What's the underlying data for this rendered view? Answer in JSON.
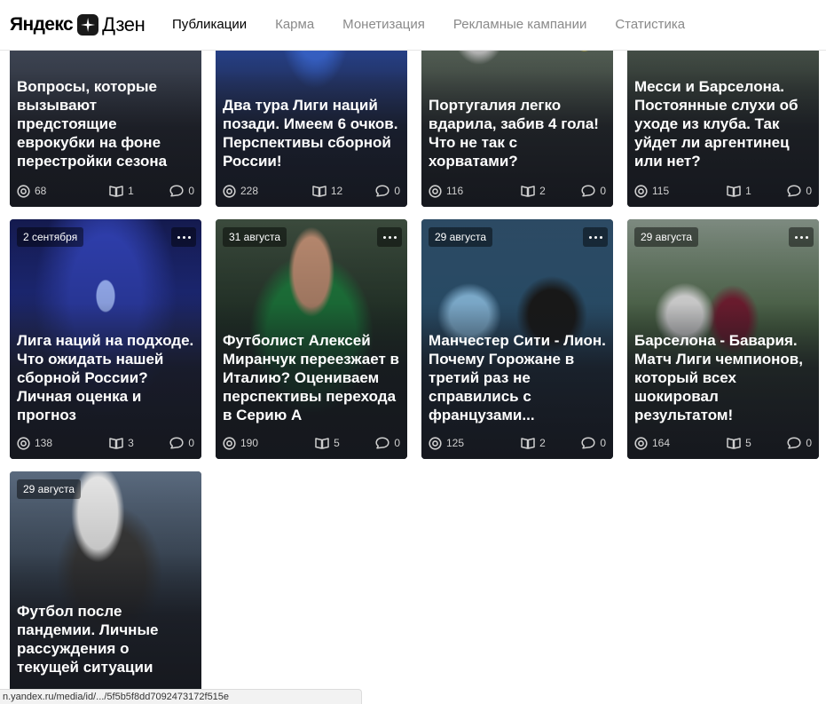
{
  "logo": {
    "yandex": "Яндекс",
    "zen": "Дзен"
  },
  "nav": [
    {
      "label": "Публикации",
      "active": true
    },
    {
      "label": "Карма",
      "active": false
    },
    {
      "label": "Монетизация",
      "active": false
    },
    {
      "label": "Рекламные кампании",
      "active": false
    },
    {
      "label": "Статистика",
      "active": false
    }
  ],
  "cards": [
    {
      "date": "",
      "title": "Вопросы, которые вызывают предстоящие еврокубки на фоне перестройки сезона",
      "views": "68",
      "reads": "1",
      "comments": "0"
    },
    {
      "date": "",
      "title": "Два тура Лиги наций позади. Имеем 6 очков. Перспективы сборной России!",
      "views": "228",
      "reads": "12",
      "comments": "0"
    },
    {
      "date": "",
      "title": "Португалия легко вдарила, забив 4 гола! Что не так с хорватами?",
      "views": "116",
      "reads": "2",
      "comments": "0"
    },
    {
      "date": "",
      "title": "Месси и Барселона. Постоянные слухи об уходе из клуба. Так уйдет ли аргентинец или нет?",
      "views": "115",
      "reads": "1",
      "comments": "0"
    },
    {
      "date": "2 сентября",
      "title": "Лига наций на подходе. Что ожидать нашей сборной России? Личная оценка и прогноз",
      "views": "138",
      "reads": "3",
      "comments": "0"
    },
    {
      "date": "31 августа",
      "title": "Футболист Алексей Миранчук переезжает в Италию? Оцениваем перспективы перехода в Серию А",
      "views": "190",
      "reads": "5",
      "comments": "0"
    },
    {
      "date": "29 августа",
      "title": "Манчестер Сити - Лион. Почему Горожане в третий раз не справились с французами...",
      "views": "125",
      "reads": "2",
      "comments": "0"
    },
    {
      "date": "29 августа",
      "title": "Барселона - Бавария. Матч Лиги чемпионов, который всех шокировал результатом!",
      "views": "164",
      "reads": "5",
      "comments": "0"
    },
    {
      "date": "29 августа",
      "title": "Футбол после пандемии. Личные рассуждения о текущей ситуации",
      "views": "",
      "reads": "",
      "comments": ""
    }
  ],
  "status_url": "n.yandex.ru/media/id/.../5f5b5f8dd7092473172f515e"
}
